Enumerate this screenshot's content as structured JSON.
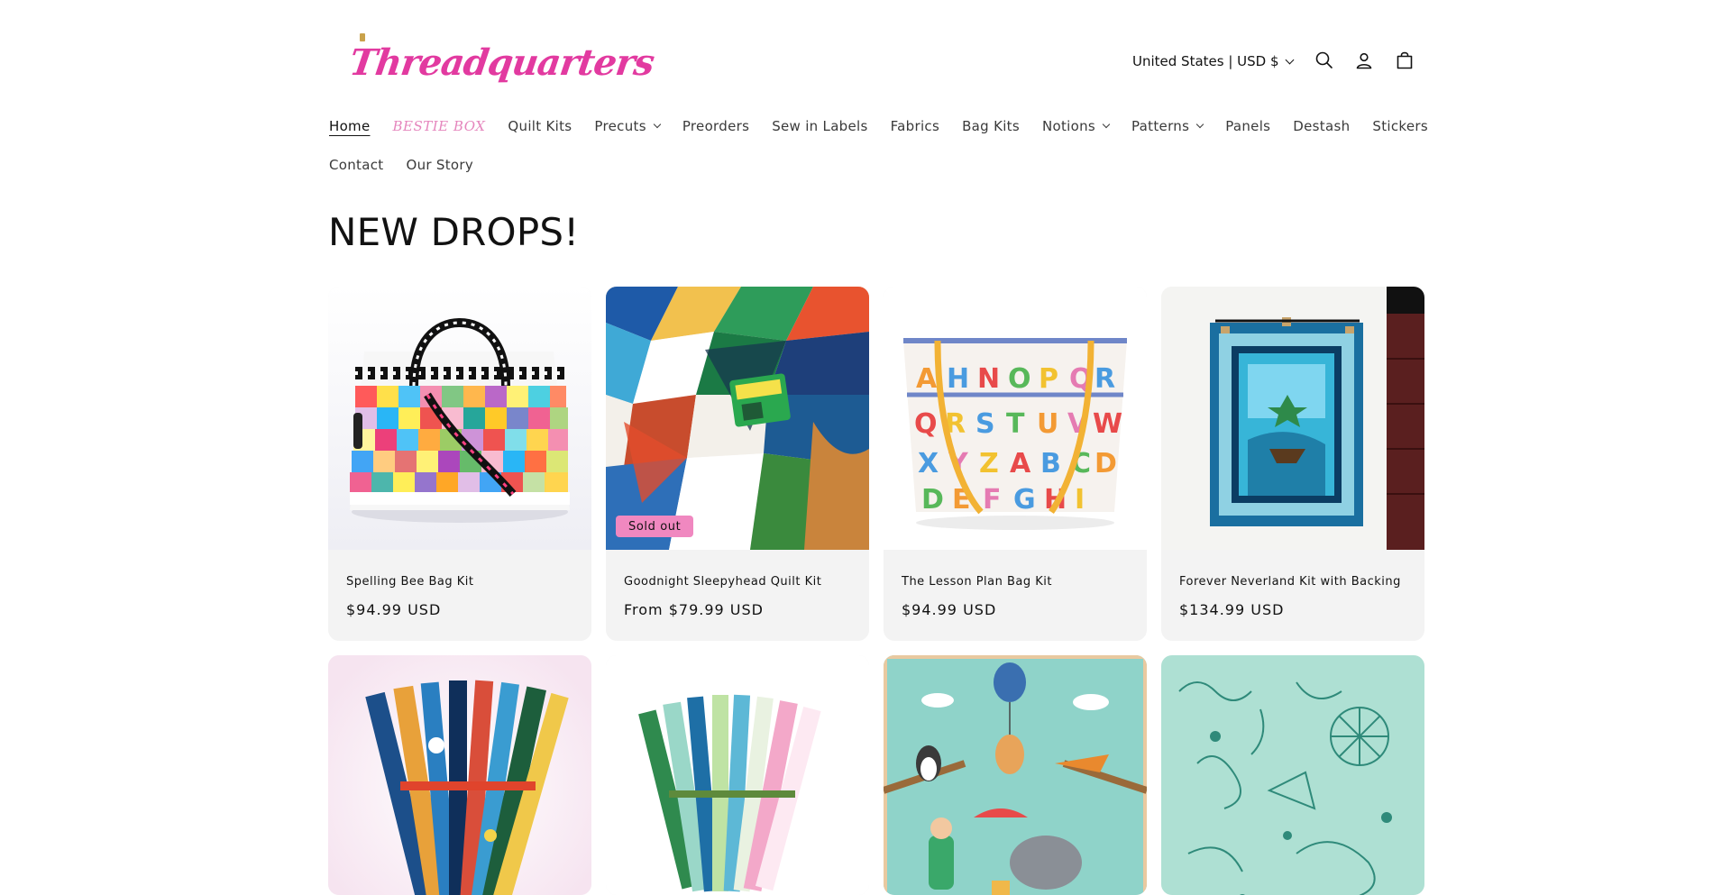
{
  "brand": {
    "name": "Threadquarters"
  },
  "header": {
    "locale_label": "United States | USD $",
    "icons": [
      "search-icon",
      "account-icon",
      "cart-icon"
    ]
  },
  "nav": {
    "row1": [
      {
        "label": "Home",
        "active": true,
        "dropdown": false
      },
      {
        "label": "BESTIE BOX",
        "active": false,
        "dropdown": false
      },
      {
        "label": "Quilt Kits",
        "active": false,
        "dropdown": false
      },
      {
        "label": "Precuts",
        "active": false,
        "dropdown": true
      },
      {
        "label": "Preorders",
        "active": false,
        "dropdown": false
      },
      {
        "label": "Sew in Labels",
        "active": false,
        "dropdown": false
      },
      {
        "label": "Fabrics",
        "active": false,
        "dropdown": false
      },
      {
        "label": "Bag Kits",
        "active": false,
        "dropdown": false
      },
      {
        "label": "Notions",
        "active": false,
        "dropdown": true
      },
      {
        "label": "Patterns",
        "active": false,
        "dropdown": true
      },
      {
        "label": "Panels",
        "active": false,
        "dropdown": false
      },
      {
        "label": "Destash",
        "active": false,
        "dropdown": false
      },
      {
        "label": "Stickers",
        "active": false,
        "dropdown": false
      }
    ],
    "row2": [
      {
        "label": "Contact",
        "active": false,
        "dropdown": false
      },
      {
        "label": "Our Story",
        "active": false,
        "dropdown": false
      }
    ]
  },
  "section": {
    "title": "NEW DROPS!"
  },
  "products": [
    {
      "name": "Spelling Bee Bag Kit",
      "price": "$94.99 USD",
      "badge": ""
    },
    {
      "name": "Goodnight Sleepyhead Quilt Kit",
      "price": "From $79.99 USD",
      "badge": "Sold out"
    },
    {
      "name": "The Lesson Plan Bag Kit",
      "price": "$94.99 USD",
      "badge": ""
    },
    {
      "name": "Forever Neverland Kit with Backing",
      "price": "$134.99 USD",
      "badge": ""
    },
    {
      "name": "",
      "price": "",
      "badge": ""
    },
    {
      "name": "",
      "price": "",
      "badge": ""
    },
    {
      "name": "",
      "price": "",
      "badge": ""
    },
    {
      "name": "",
      "price": "",
      "badge": ""
    }
  ],
  "colors": {
    "brand_pink": "#e23aa0",
    "badge_pink": "#f088c0",
    "card_bg": "#f3f3f3"
  }
}
